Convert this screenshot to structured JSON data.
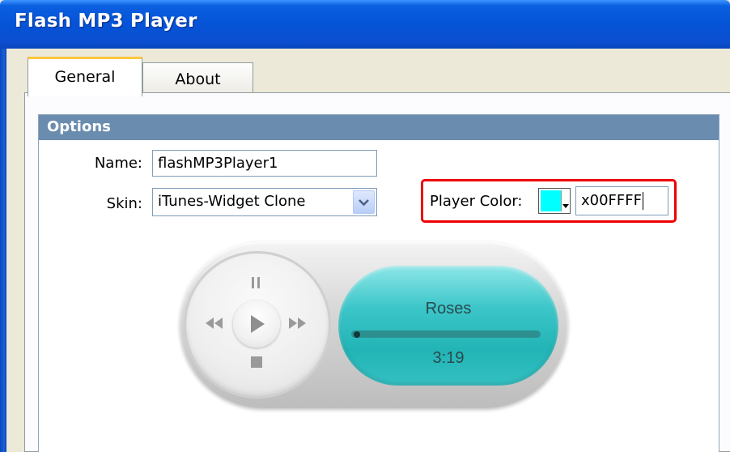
{
  "window": {
    "title": "Flash MP3 Player"
  },
  "tabs": [
    {
      "label": "General",
      "active": true
    },
    {
      "label": "About",
      "active": false
    }
  ],
  "options": {
    "header": "Options",
    "name_label": "Name:",
    "name_value": "flashMP3Player1",
    "skin_label": "Skin:",
    "skin_value": "iTunes-Widget Clone",
    "player_color_label": "Player Color:",
    "player_color_value": "x00FFFF",
    "player_color_swatch": "#00FFFF"
  },
  "player": {
    "song_title": "Roses",
    "time": "3:19",
    "progress": 0.0
  },
  "colors": {
    "titlebar": "#0553D6",
    "group_header": "#6A8CAF",
    "highlight": "#EE0000",
    "display": "#22B4B6"
  }
}
